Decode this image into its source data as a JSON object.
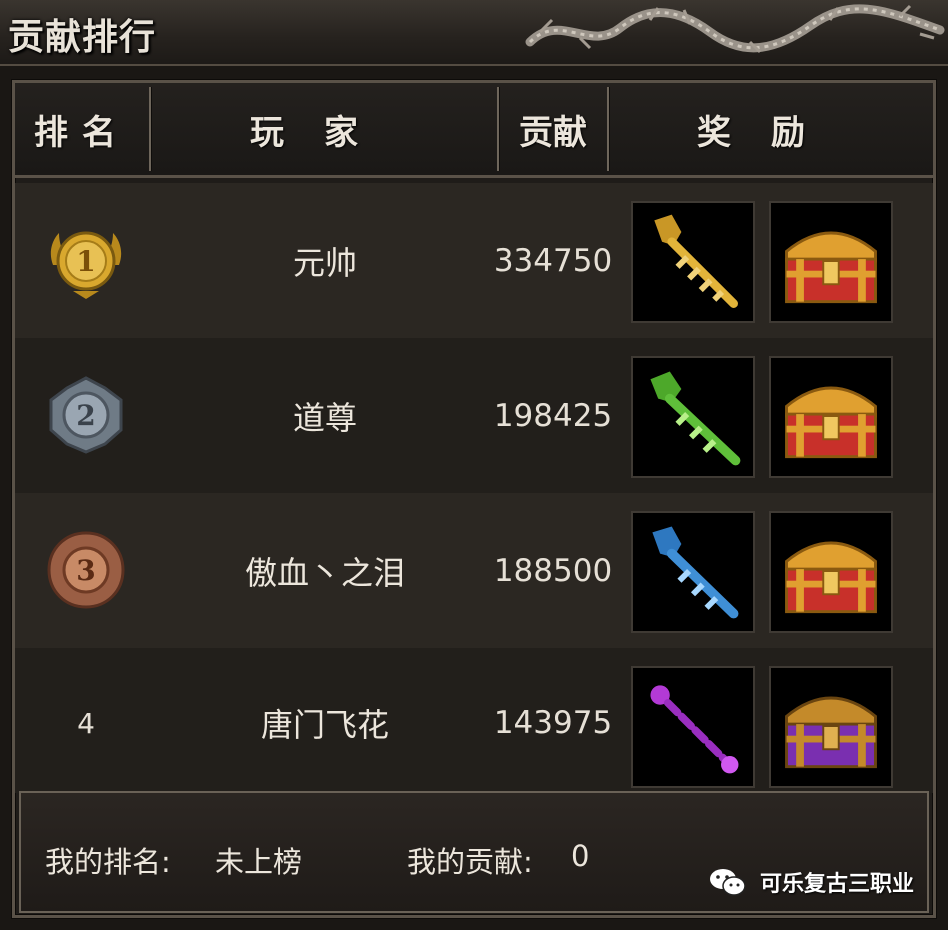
{
  "window": {
    "title": "贡献排行"
  },
  "table": {
    "headers": {
      "rank": "排名",
      "player": "玩家",
      "contribution": "贡献",
      "reward": "奖励"
    },
    "rows": [
      {
        "rank": "1",
        "player": "元帅",
        "contribution": "334750",
        "medal": "gold",
        "reward_item": "gold-key",
        "reward_chest": "red-gold-chest"
      },
      {
        "rank": "2",
        "player": "道尊",
        "contribution": "198425",
        "medal": "silver",
        "reward_item": "green-key",
        "reward_chest": "red-gold-chest"
      },
      {
        "rank": "3",
        "player": "傲血丶之泪",
        "contribution": "188500",
        "medal": "bronze",
        "reward_item": "blue-key",
        "reward_chest": "red-gold-chest"
      },
      {
        "rank": "4",
        "player": "唐门飞花",
        "contribution": "143975",
        "medal": "",
        "reward_item": "purple-key",
        "reward_chest": "purple-chest"
      }
    ]
  },
  "footer": {
    "my_rank_label": "我的排名:",
    "my_rank_value": "未上榜",
    "my_contribution_label": "我的贡献:",
    "my_contribution_value": "0"
  },
  "watermark": {
    "text": "可乐复古三职业"
  },
  "colors": {
    "gold": "#d9a82e",
    "silver": "#8a96a2",
    "bronze": "#b8785a",
    "green_key": "#5fbf3a",
    "blue_key": "#3f8fd6",
    "purple_key": "#b33ad6",
    "chest_red": "#c8302a",
    "chest_purple": "#7a2fb0",
    "chest_gold": "#e0a030"
  }
}
